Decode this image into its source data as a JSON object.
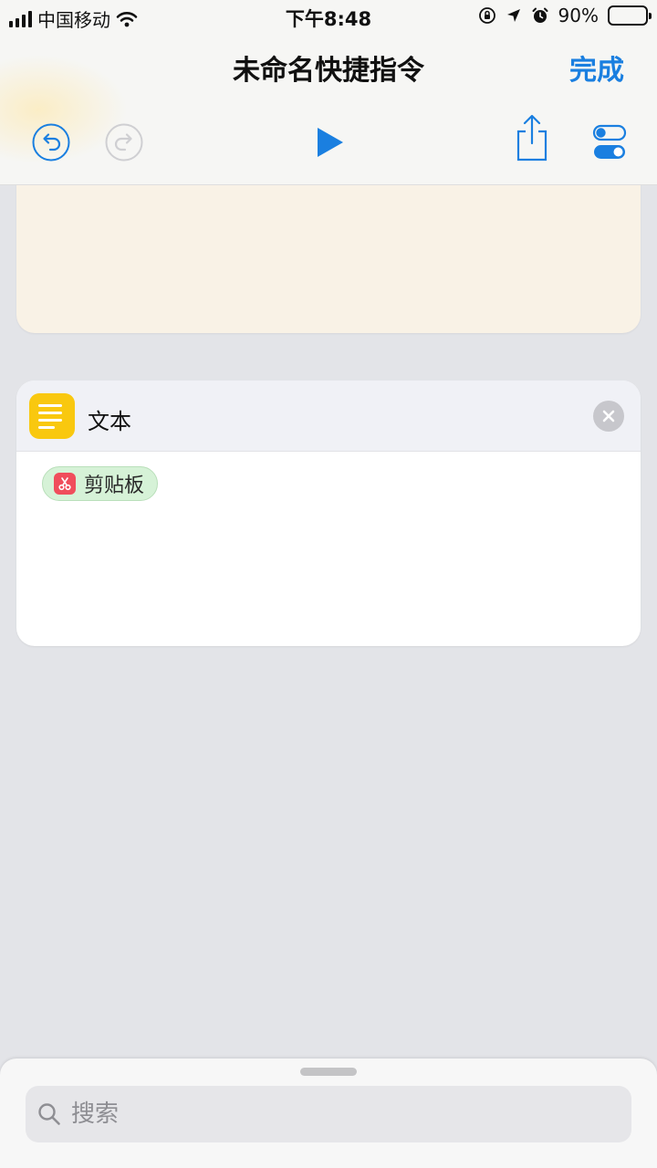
{
  "status_bar": {
    "carrier": "中国移动",
    "time": "下午8:48",
    "battery_percent": "90%",
    "battery_level": 0.9,
    "icons": [
      "signal-icon",
      "wifi-icon",
      "orientation-lock-icon",
      "location-icon",
      "alarm-icon",
      "battery-icon"
    ]
  },
  "nav": {
    "title": "未命名快捷指令",
    "done_label": "完成"
  },
  "toolbar": {
    "icons": [
      "undo-icon",
      "redo-icon",
      "play-icon",
      "share-icon",
      "settings-toggle-icon"
    ]
  },
  "actions": [
    {
      "title": "文本",
      "icon": "text-lines-icon",
      "token": {
        "label": "剪贴板",
        "icon": "scissors-icon"
      }
    }
  ],
  "search": {
    "placeholder": "搜索"
  },
  "colors": {
    "accent": "#1a7fe0",
    "text_action_icon": "#f9c80f",
    "clipboard_token_bg": "#d6f2d7",
    "clipboard_icon_bg": "#f04d5b"
  }
}
